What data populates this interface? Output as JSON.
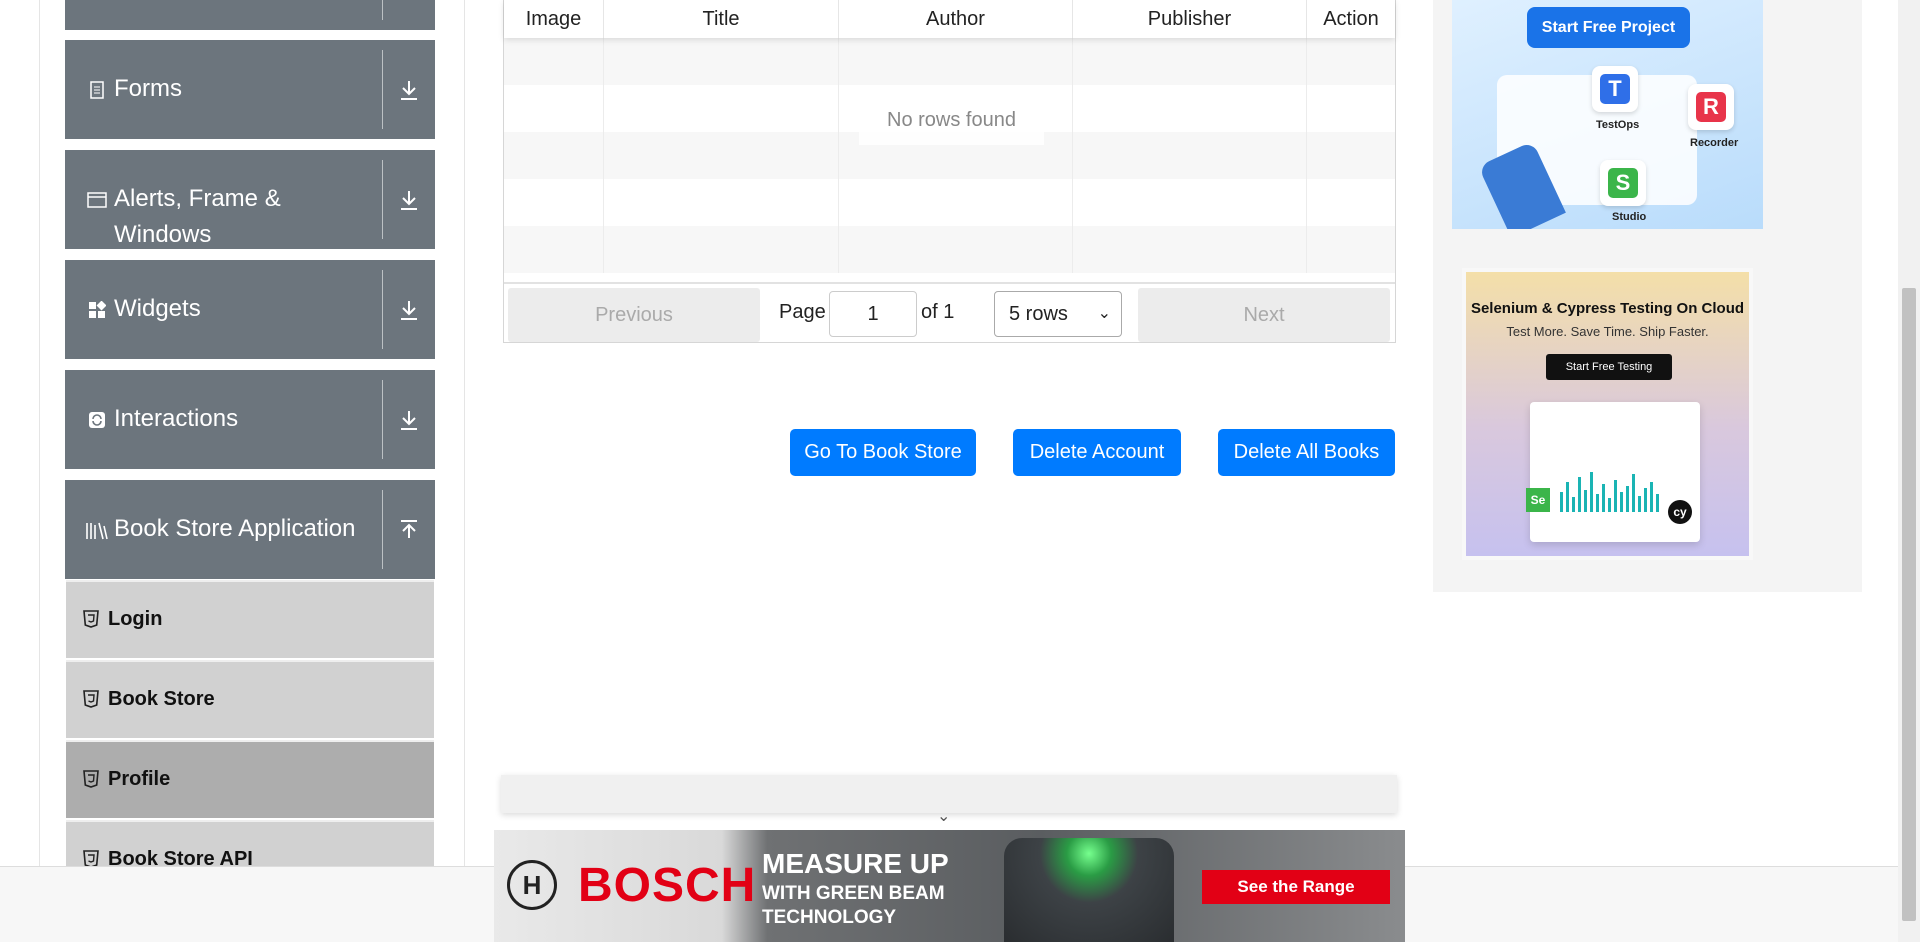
{
  "sidebar": {
    "groups": [
      {
        "label": "Forms",
        "icon": "document-icon"
      },
      {
        "label": "Alerts, Frame &",
        "label2": "Windows",
        "icon": "window-icon"
      },
      {
        "label": "Widgets",
        "icon": "widgets-icon"
      },
      {
        "label": "Interactions",
        "icon": "interactions-icon"
      },
      {
        "label": "Book Store Application",
        "icon": "books-icon"
      }
    ],
    "items": [
      {
        "label": "Login"
      },
      {
        "label": "Book Store"
      },
      {
        "label": "Profile"
      },
      {
        "label": "Book Store API"
      }
    ]
  },
  "table": {
    "headers": [
      "Image",
      "Title",
      "Author",
      "Publisher",
      "Action"
    ],
    "empty_text": "No rows found",
    "previous_label": "Previous",
    "next_label": "Next",
    "page_label": "Page",
    "page_value": "1",
    "of_label": "of 1",
    "rows_option": "5 rows"
  },
  "actions": {
    "go_to_store": "Go To Book Store",
    "delete_account": "Delete Account",
    "delete_all_books": "Delete All Books"
  },
  "ads": {
    "ad1": {
      "cta": "Start Free Project",
      "tiles": [
        {
          "letter": "T",
          "label": "TestOps"
        },
        {
          "letter": "R",
          "label": "Recorder"
        },
        {
          "letter": "S",
          "label": "Studio"
        }
      ]
    },
    "ad2": {
      "title": "Selenium & Cypress Testing On Cloud",
      "subtitle": "Test More. Save Time. Ship Faster.",
      "cta": "Start Free Testing",
      "badge1": "Se",
      "badge2": "cy"
    },
    "bosch": {
      "brand": "BOSCH",
      "headline": "MEASURE UP",
      "subline": "WITH GREEN BEAM TECHNOLOGY",
      "cta": "See the Range"
    }
  },
  "colors": {
    "sidebar_group": "#6c757d",
    "sidebar_item": "#d1d1d1",
    "sidebar_item_active": "#adadad",
    "primary": "#007bff",
    "bosch_red": "#e20015"
  }
}
